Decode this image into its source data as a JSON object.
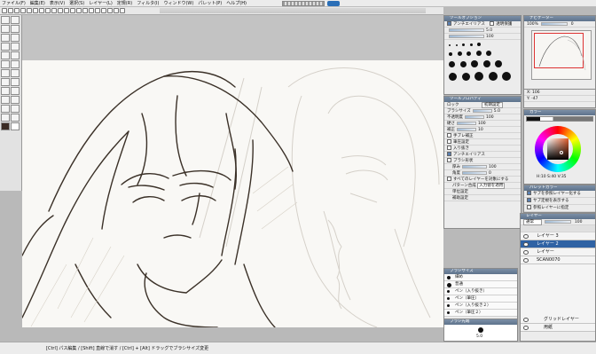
{
  "menubar": {
    "items": [
      "ファイル(F)",
      "編集(E)",
      "表示(V)",
      "選択(S)",
      "レイヤー(L)",
      "定規(R)",
      "フィルタ(I)",
      "ウィンドウ(W)",
      "パレット(P)",
      "ヘルプ(H)"
    ]
  },
  "statusbar": {
    "text": "[Ctrl] パス編集 / [Shift] 直線で消す / [Ctrl] + [Alt] ドラッグでブラシサイズ変更"
  },
  "brush_panel": {
    "title": "ツールオプション",
    "aa_label": "アンチエイリアス",
    "opacity_label": "透明保護",
    "size_value": "5.0",
    "density_value": "100",
    "sizes": [
      "1.0",
      "1.5",
      "2.0",
      "2.5",
      "3.0",
      "3.5",
      "4.0",
      "5.0",
      "6.0",
      "7.0",
      "8.0",
      "10",
      "12",
      "15",
      "17",
      "20",
      "25",
      "30",
      "40",
      "50"
    ]
  },
  "tool_panel": {
    "title": "ツールプロパティ",
    "lock_label": "ロック",
    "reset_label": "初期設定",
    "rows": [
      {
        "label": "ブラシサイズ",
        "value": "5.0"
      },
      {
        "label": "不透明度",
        "value": "100"
      },
      {
        "label": "硬さ",
        "value": "100"
      },
      {
        "label": "補正",
        "value": "10"
      },
      {
        "label": "手ブレ補正",
        "value": ""
      },
      {
        "label": "筆圧設定",
        "value": ""
      },
      {
        "label": "入り抜き",
        "value": ""
      },
      {
        "label": "アンチエイリアス",
        "value": ""
      },
      {
        "label": "ブラシ形状",
        "value": ""
      },
      {
        "label": "厚み",
        "value": "100"
      },
      {
        "label": "角度",
        "value": "0"
      },
      {
        "label": "すべてのレイヤーを対象にする",
        "value": ""
      },
      {
        "label": "パターン合成",
        "value": "入力値を適用"
      },
      {
        "label": "単位設定",
        "value": ""
      },
      {
        "label": "補助設定",
        "value": ""
      }
    ]
  },
  "nav_panel": {
    "title": "ナビゲーター",
    "zoom": "100%",
    "angle": "0"
  },
  "info_panel": {
    "x_label": "X: 106",
    "y_label": "Y: -47"
  },
  "color_panel": {
    "title": "カラー",
    "hsv": "H:10 S:40 V:35",
    "accent_color": "#7a3f2a"
  },
  "palette_panel": {
    "title": "パレットカラー",
    "items": [
      "サブを参照レイヤー化する",
      "サブ定規を表示する",
      "参照レイヤーに指定"
    ]
  },
  "layer_panel": {
    "title": "レイヤー",
    "blend_mode": "通常",
    "opacity": "100",
    "layers": [
      {
        "name": "レイヤー 3",
        "selected": false
      },
      {
        "name": "レイヤー 2",
        "selected": true
      },
      {
        "name": "レイヤー",
        "selected": false
      },
      {
        "name": "SCAN0070",
        "selected": false
      }
    ],
    "bottom_items": [
      "グリッドレイヤー",
      "用紙"
    ]
  },
  "preset_panel": {
    "title": "ブラシサイズ",
    "rows": [
      "細め",
      "普通",
      "ペン（入り抜き）",
      "ペン（筆圧）",
      "ペン（入り抜き２）",
      "ペン（筆圧２）"
    ]
  },
  "brushtip_panel": {
    "title": "ブラシ先端",
    "value": "5.0"
  }
}
